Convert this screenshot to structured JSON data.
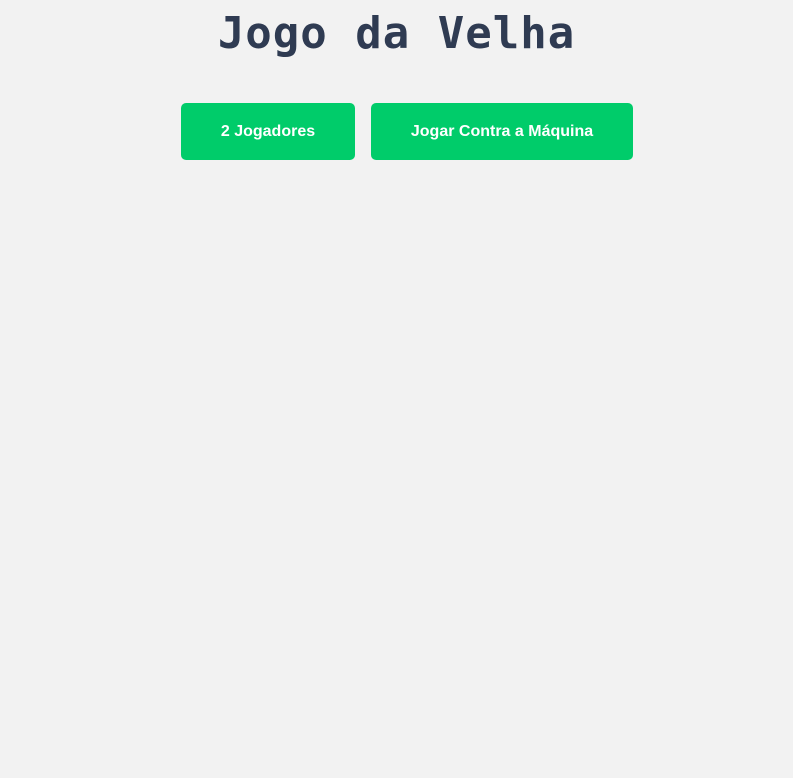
{
  "header": {
    "title": "Jogo da Velha"
  },
  "menu": {
    "two_players_label": "2 Jogadores",
    "vs_computer_label": "Jogar Contra a Máquina"
  },
  "colors": {
    "background": "#f2f2f2",
    "title": "#2f3b52",
    "button": "#00cc6a",
    "button_text": "#ffffff"
  }
}
